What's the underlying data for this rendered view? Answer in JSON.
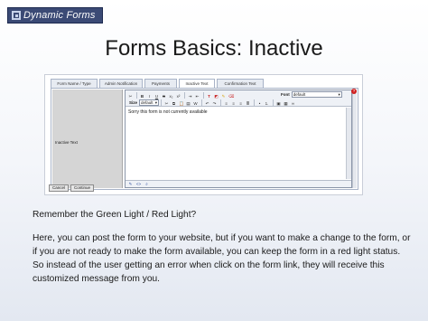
{
  "logo": {
    "text": "Dynamic Forms"
  },
  "slide": {
    "title": "Forms Basics:  Inactive"
  },
  "form_editor": {
    "tabs": [
      {
        "label": "Form Name / Type",
        "active": false
      },
      {
        "label": "Admin Notification",
        "active": false
      },
      {
        "label": "Payments",
        "active": false
      },
      {
        "label": "Inactive Text",
        "active": true
      },
      {
        "label": "Confirmation Text",
        "active": false
      }
    ],
    "field_label": "Inactive Text",
    "toolbar": {
      "size_label": "Size",
      "size_value": "default",
      "font_label": "Font",
      "font_value": "default",
      "row1_icons": [
        "cut-icon",
        "bold-icon",
        "italic-icon",
        "underline-icon",
        "strike-icon",
        "subscript-icon",
        "superscript-icon",
        "indent-icon",
        "outdent-icon",
        "text-color-icon",
        "bg-color-icon",
        "highlight-icon",
        "clear-format-icon"
      ],
      "row2_icons": [
        "cut-icon",
        "copy-icon",
        "paste-icon",
        "paste-text-icon",
        "paste-word-icon",
        "undo-icon",
        "redo-icon",
        "align-left-icon",
        "align-center-icon",
        "align-right-icon",
        "justify-icon",
        "bullet-list-icon",
        "number-list-icon",
        "image-icon",
        "table-icon",
        "link-icon"
      ]
    },
    "editor_text": "Sorry this form is not currently available",
    "help_badge": "?",
    "cancel_label": "Cancel",
    "continue_label": "Continue"
  },
  "body": {
    "paragraph1": "Remember the Green Light / Red Light?",
    "paragraph2": "Here, you can post the form to your website, but if you want to make a change to the form, or if you are not ready to make the form available, you can keep the form in a red light status.   So instead of the user getting an error when click on the form link, they will receive this customized message from you."
  }
}
